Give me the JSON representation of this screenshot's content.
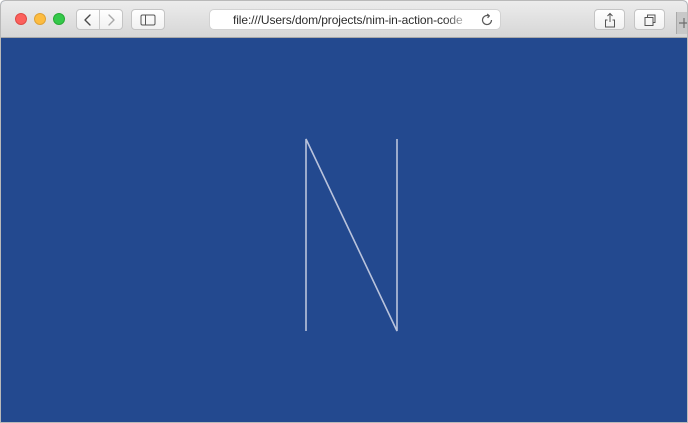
{
  "window": {
    "title": ""
  },
  "address_bar": {
    "url": "file:///Users/dom/projects/nim-in-action-code"
  },
  "icons": {
    "back": "chevron-left-icon",
    "forward": "chevron-right-icon",
    "sidebar": "sidebar-icon",
    "reload": "reload-icon",
    "share": "share-icon",
    "tabs": "tabs-icon",
    "new_tab": "plus-icon"
  },
  "colors": {
    "page_background": "#23498f",
    "stroke": "#b9c3dc",
    "close": "#fc605c",
    "minimize": "#fdbc40",
    "maximize": "#34c84a"
  },
  "canvas": {
    "drawn_letter": "N"
  }
}
